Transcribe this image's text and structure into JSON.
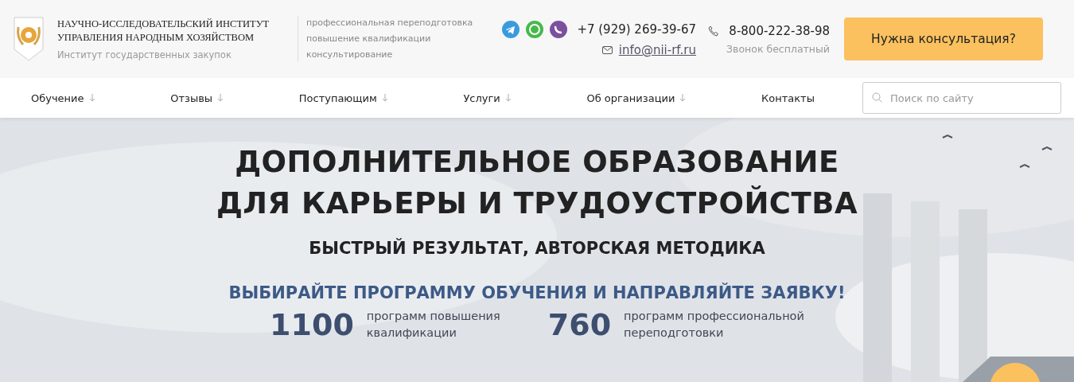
{
  "header": {
    "org_name": [
      "НАУЧНО-ИССЛЕДОВАТЕЛЬСКИЙ ИНСТИТУТ",
      "УПРАВЛЕНИЯ НАРОДНЫМ ХОЗЯЙСТВОМ"
    ],
    "org_subtitle": "Институт государственных закупок",
    "services": [
      "профессиональная переподготовка",
      "повышение квалификации",
      "консультирование"
    ],
    "phone": "+7 (929) 269-39-67",
    "email": "info@nii-rf.ru",
    "free_phone": "8-800-222-38-98",
    "free_phone_note": "Звонок бесплатный",
    "cta_button": "Нужна консультация?"
  },
  "nav": {
    "items": [
      {
        "label": "Обучение",
        "has_dropdown": true
      },
      {
        "label": "Отзывы",
        "has_dropdown": true
      },
      {
        "label": "Поступающим",
        "has_dropdown": true
      },
      {
        "label": "Услуги",
        "has_dropdown": true
      },
      {
        "label": "Об организации",
        "has_dropdown": true
      },
      {
        "label": "Контакты",
        "has_dropdown": false
      }
    ],
    "search": {
      "placeholder": "Поиск по сайту"
    }
  },
  "hero": {
    "kind": "picture",
    "title": [
      "ДОПОЛНИТЕЛЬНОЕ ОБРАЗОВАНИЕ",
      "ДЛЯ КАРЬЕРЫ И ТРУДОУСТРОЙСТВА"
    ],
    "subtitle": "БЫСТРЫЙ РЕЗУЛЬТАТ, АВТОРСКАЯ МЕТОДИКА",
    "call_to_action": "ВЫБИРАЙТЕ ПРОГРАММУ ОБУЧЕНИЯ И НАПРАВЛЯЙТЕ ЗАЯВКУ!",
    "stats": [
      {
        "value": "1100",
        "label": [
          "программ повышения",
          "квалификации"
        ]
      },
      {
        "value": "760",
        "label": [
          "программ профессиональной",
          "переподготовки"
        ]
      }
    ]
  }
}
